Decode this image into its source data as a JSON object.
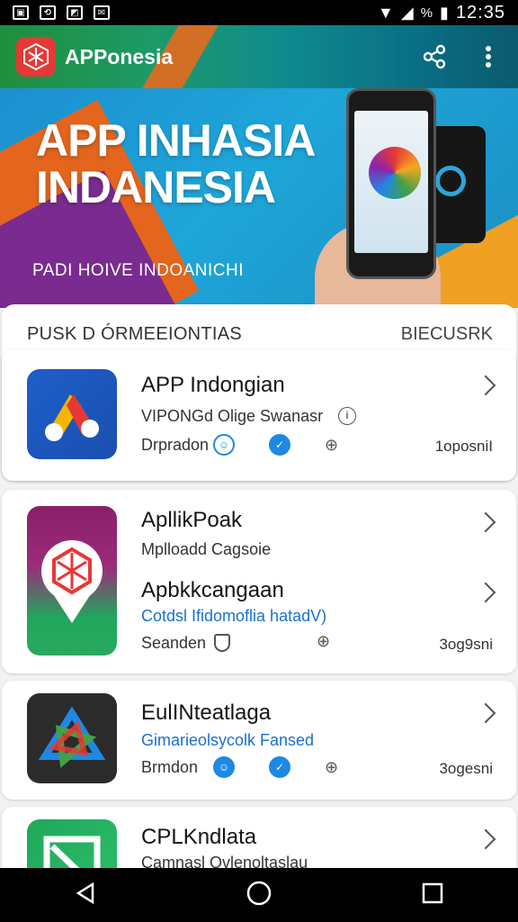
{
  "status_bar": {
    "time": "12:35",
    "battery": "%"
  },
  "app_bar": {
    "title": "APPonesia",
    "share_icon": "share-icon",
    "menu_icon": "more-vert-icon"
  },
  "banner": {
    "headline_line1": "APP INHASIA",
    "headline_line2": "INDANESIA",
    "subtitle": "PADI HOIVE INDOANICHI"
  },
  "section": {
    "title": "PUSK D ÓRMEEIONTIAS",
    "action": "BIECUSRK"
  },
  "apps": [
    {
      "name": "APP Indongian",
      "subtitle": "VIPONGd Olige Swanasr",
      "meta_label": "Drpradon",
      "count": "1oposniI"
    },
    {
      "name": "ApllikPoak",
      "subtitle": "Mplloadd Cagsoie"
    },
    {
      "name": "Apbkkcangaan",
      "subtitle": "Cotdsl Ifidomoflia hatadV)",
      "meta_label": "Seanden",
      "count": "3og9sni"
    },
    {
      "name": "EulINteatlaga",
      "subtitle": "Gimarieolsycolk Fansed",
      "meta_label": "Brmdon",
      "count": "3ogesni"
    },
    {
      "name": "CPLKndlata",
      "subtitle": "Camnasl Ovlenoltaslau"
    }
  ],
  "nav": {
    "back": "back-icon",
    "home": "home-icon",
    "recents": "recents-icon"
  },
  "colors": {
    "accent_blue": "#1e88e5",
    "logo_red": "#e53935"
  }
}
